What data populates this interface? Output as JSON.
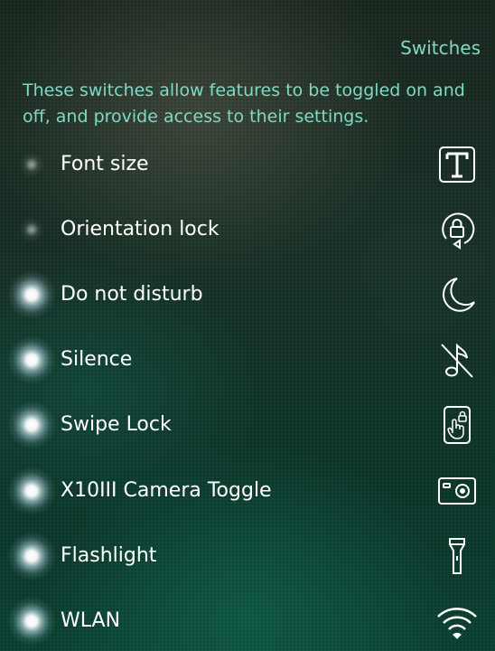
{
  "header": {
    "title": "Switches"
  },
  "description": "These switches allow features to be toggled on and off, and provide access to their settings.",
  "switches": [
    {
      "label": "Font size",
      "active": false,
      "icon": "font-size-icon"
    },
    {
      "label": "Orientation lock",
      "active": false,
      "icon": "orientation-lock-icon"
    },
    {
      "label": "Do not disturb",
      "active": true,
      "icon": "moon-icon"
    },
    {
      "label": "Silence",
      "active": true,
      "icon": "muted-note-icon"
    },
    {
      "label": "Swipe Lock",
      "active": true,
      "icon": "swipe-lock-icon"
    },
    {
      "label": "X10III Camera Toggle",
      "active": true,
      "icon": "camera-icon"
    },
    {
      "label": "Flashlight",
      "active": true,
      "icon": "flashlight-icon"
    },
    {
      "label": "WLAN",
      "active": true,
      "icon": "wifi-icon"
    }
  ],
  "colors": {
    "accent": "#7fd9c4",
    "label": "#ffffff"
  }
}
